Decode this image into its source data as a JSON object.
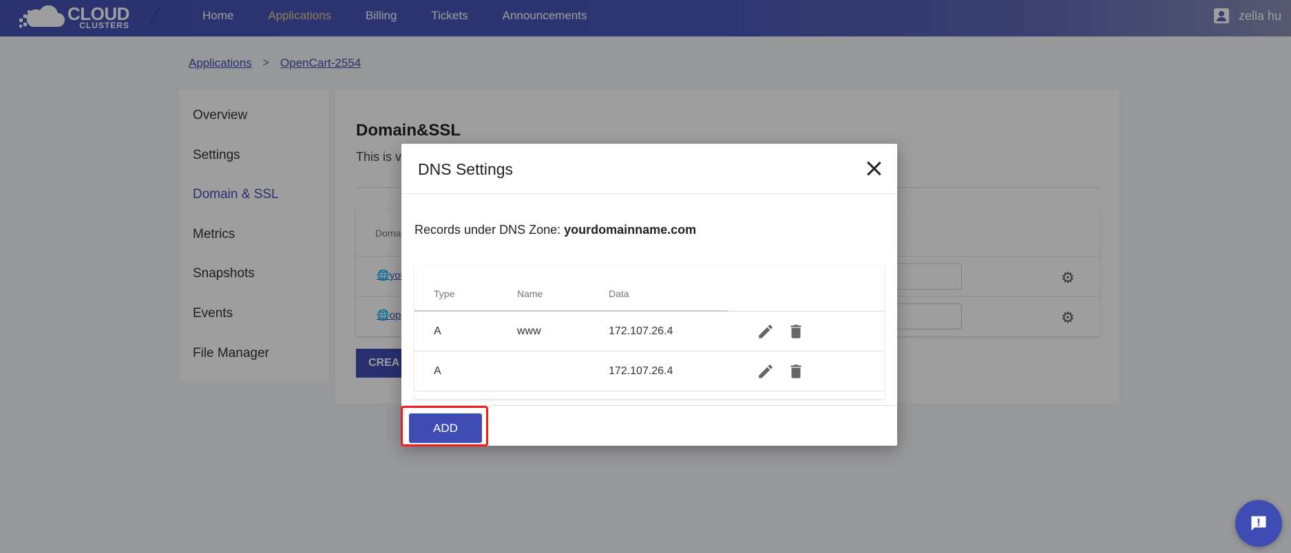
{
  "app": {
    "logo_big": "CLOUD",
    "logo_small": "CLUSTERS"
  },
  "nav": {
    "items": [
      {
        "label": "Home",
        "active": false
      },
      {
        "label": "Applications",
        "active": true
      },
      {
        "label": "Billing",
        "active": false
      },
      {
        "label": "Tickets",
        "active": false
      },
      {
        "label": "Announcements",
        "active": false
      }
    ],
    "user_name": "zella hu",
    "active_color": "#e8c98a"
  },
  "breadcrumb": {
    "root": "Applications",
    "separator": ">",
    "current": "OpenCart-2554"
  },
  "sidebar": {
    "items": [
      {
        "label": "Overview"
      },
      {
        "label": "Settings"
      },
      {
        "label": "Domain & SSL",
        "active": true
      },
      {
        "label": "Metrics"
      },
      {
        "label": "Snapshots"
      },
      {
        "label": "Events"
      },
      {
        "label": "File Manager"
      }
    ]
  },
  "main": {
    "title": "Domain&SSL",
    "description_visible": "This is v",
    "table_header_visible": "Doma",
    "rows": [
      {
        "domain_visible": "you"
      },
      {
        "domain_visible": "op"
      }
    ],
    "create_button_visible": "CREA"
  },
  "modal": {
    "title": "DNS Settings",
    "zone_label": "Records under DNS Zone:",
    "zone_name": "yourdomainname.com",
    "columns": [
      "Type",
      "Name",
      "Data"
    ],
    "records": [
      {
        "type": "A",
        "name": "www",
        "data": "172.107.26.4"
      },
      {
        "type": "A",
        "name": "",
        "data": "172.107.26.4"
      }
    ],
    "add_label": "ADD",
    "highlight_color": "#f21d1d"
  },
  "theme": {
    "primary": "#3f4cb3",
    "nav_bg": "#4452b4"
  }
}
